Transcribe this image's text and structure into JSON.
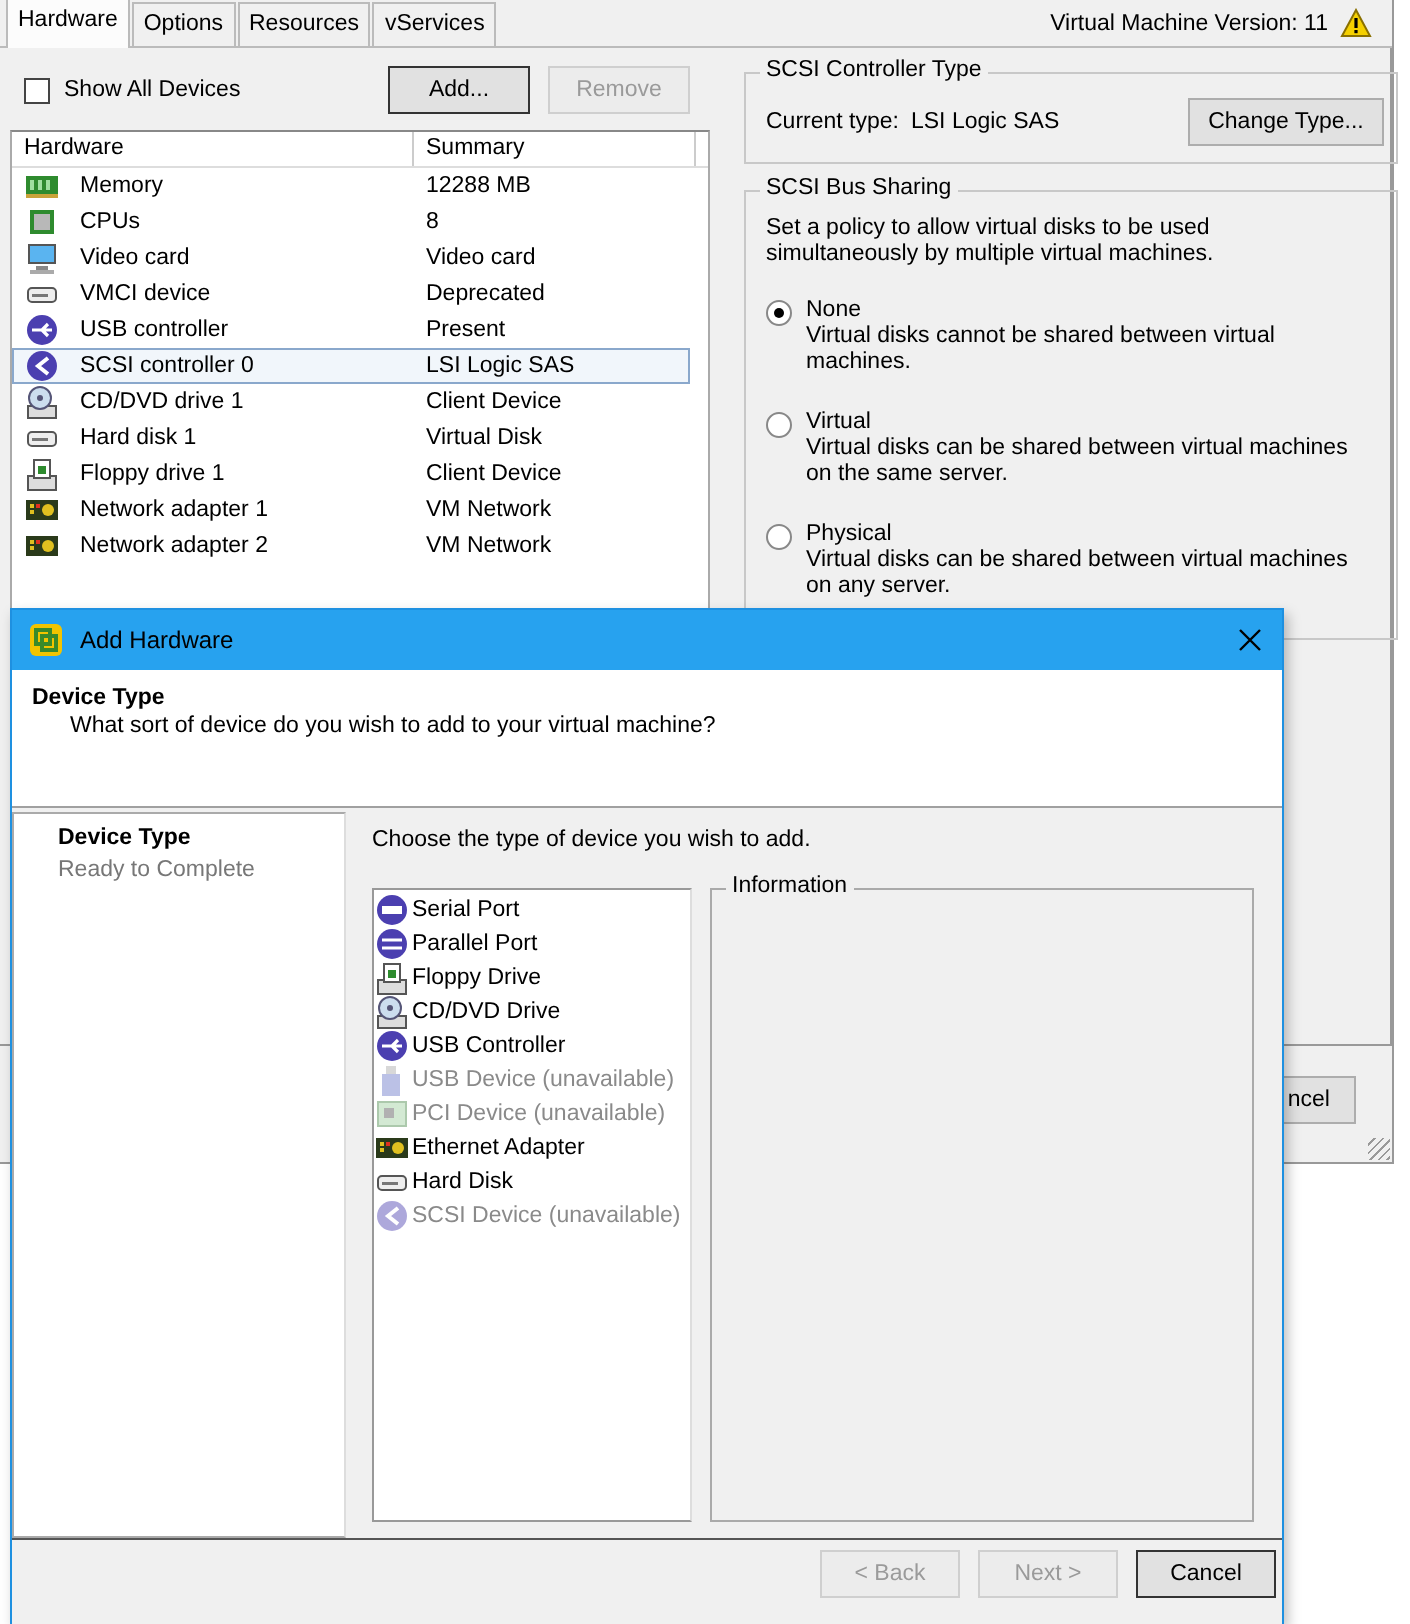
{
  "tabs": [
    {
      "label": "Hardware",
      "selected": true
    },
    {
      "label": "Options",
      "selected": false
    },
    {
      "label": "Resources",
      "selected": false
    },
    {
      "label": "vServices",
      "selected": false
    }
  ],
  "version": {
    "label": "Virtual Machine Version: 11",
    "warning": true
  },
  "show_all_devices": {
    "label": "Show All Devices",
    "checked": false
  },
  "buttons": [
    {
      "label": "Add...",
      "disabled": false
    },
    {
      "label": "Remove",
      "disabled": true
    }
  ],
  "hardware_table": {
    "columns": [
      "Hardware",
      "Summary"
    ],
    "rows": [
      {
        "kind": "memory",
        "name": "Memory",
        "summary": "12288 MB",
        "selected": false
      },
      {
        "kind": "cpu",
        "name": "CPUs",
        "summary": "8",
        "selected": false
      },
      {
        "kind": "video",
        "name": "Video card",
        "summary": "Video card",
        "selected": false
      },
      {
        "kind": "drive",
        "name": "VMCI device",
        "summary": "Deprecated",
        "selected": false
      },
      {
        "kind": "usb",
        "name": "USB controller",
        "summary": "Present",
        "selected": false
      },
      {
        "kind": "scsi",
        "name": "SCSI controller 0",
        "summary": "LSI Logic SAS",
        "selected": true
      },
      {
        "kind": "cdrom",
        "name": "CD/DVD drive 1",
        "summary": "Client Device",
        "selected": false
      },
      {
        "kind": "drive",
        "name": "Hard disk 1",
        "summary": "Virtual Disk",
        "selected": false
      },
      {
        "kind": "floppy",
        "name": "Floppy drive 1",
        "summary": "Client Device",
        "selected": false
      },
      {
        "kind": "network",
        "name": "Network adapter 1",
        "summary": "VM Network",
        "selected": false
      },
      {
        "kind": "network",
        "name": "Network adapter 2",
        "summary": "VM Network",
        "selected": false
      }
    ]
  },
  "scsi_controller_type": {
    "title": "SCSI Controller Type",
    "current_type_label": "Current type:",
    "current_type": "LSI Logic SAS",
    "button": "Change Type..."
  },
  "scsi_bus_sharing": {
    "title": "SCSI Bus Sharing",
    "description": "Set a policy to allow virtual disks to be used simultaneously by multiple virtual machines.",
    "options": [
      {
        "label": "None",
        "description": "Virtual disks cannot be shared between virtual machines.",
        "selected": true
      },
      {
        "label": "Virtual",
        "description": "Virtual disks can be shared between virtual machines on the same server.",
        "selected": false
      },
      {
        "label": "Physical",
        "description": "Virtual disks can be shared between virtual machines on any server.",
        "selected": false
      }
    ]
  },
  "background_button": {
    "label": "ncel"
  },
  "dialog": {
    "title": "Add Hardware",
    "header_title": "Device Type",
    "header_subtitle": "What sort of device do you wish to add to your virtual machine?",
    "steps": [
      {
        "label": "Device Type",
        "selected": true
      },
      {
        "label": "Ready to Complete",
        "selected": false
      }
    ],
    "instruction": "Choose the type of device you wish to add.",
    "devices": [
      {
        "kind": "serial",
        "label": "Serial Port",
        "disabled": false
      },
      {
        "kind": "parallel",
        "label": "Parallel Port",
        "disabled": false
      },
      {
        "kind": "floppy",
        "label": "Floppy Drive",
        "disabled": false
      },
      {
        "kind": "cdrom",
        "label": "CD/DVD Drive",
        "disabled": false
      },
      {
        "kind": "usb",
        "label": "USB Controller",
        "disabled": false
      },
      {
        "kind": "usbdevice",
        "label": "USB Device (unavailable)",
        "disabled": true
      },
      {
        "kind": "pci",
        "label": "PCI Device (unavailable)",
        "disabled": true
      },
      {
        "kind": "network",
        "label": "Ethernet Adapter",
        "disabled": false
      },
      {
        "kind": "drive",
        "label": "Hard Disk",
        "disabled": false
      },
      {
        "kind": "scsi",
        "label": "SCSI Device (unavailable)",
        "disabled": true
      }
    ],
    "information_title": "Information",
    "buttons": [
      {
        "label": "< Back",
        "disabled": true
      },
      {
        "label": "Next >",
        "disabled": true
      },
      {
        "label": "Cancel",
        "disabled": false
      }
    ]
  }
}
